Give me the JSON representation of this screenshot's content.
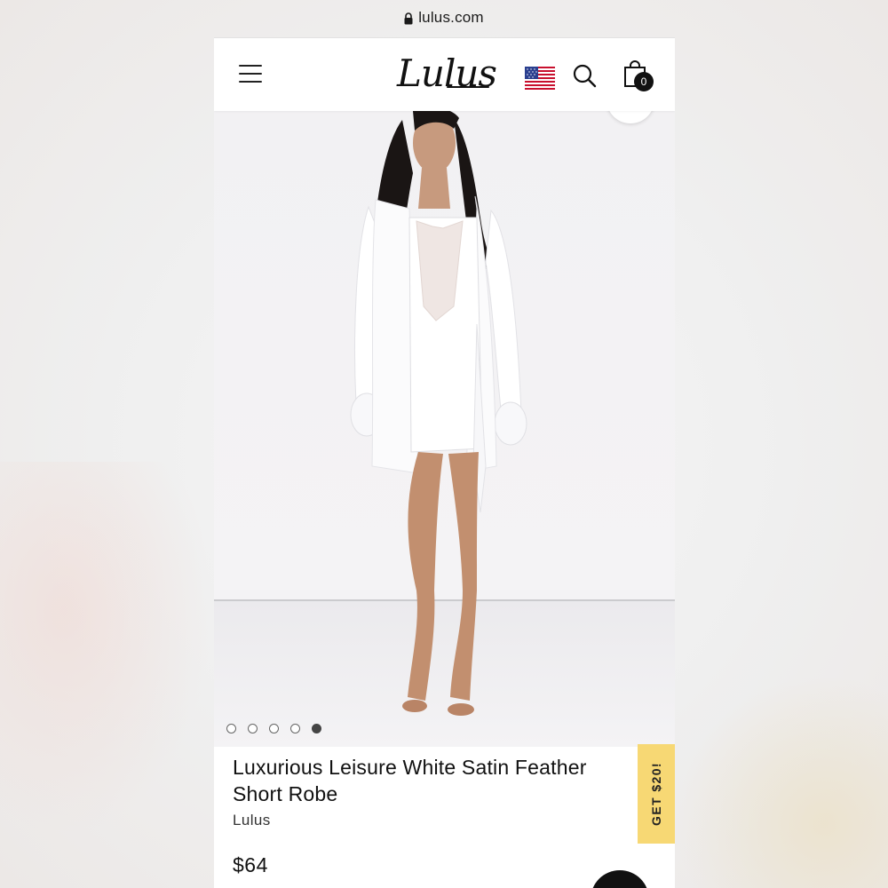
{
  "browser": {
    "url": "lulus.com"
  },
  "header": {
    "logo_text": "Lulus",
    "cart_count": "0",
    "flag": "us-flag-icon"
  },
  "gallery": {
    "image_count": 5,
    "active_index": 4
  },
  "product": {
    "title": "Luxurious Leisure White Satin Feather Short Robe",
    "brand": "Lulus",
    "price": "$64"
  },
  "promo": {
    "label": "GET $20!",
    "color": "#f7d874"
  },
  "colors": {
    "header_bg": "#ffffff",
    "text": "#111111",
    "promo_bg": "#f7d874"
  }
}
